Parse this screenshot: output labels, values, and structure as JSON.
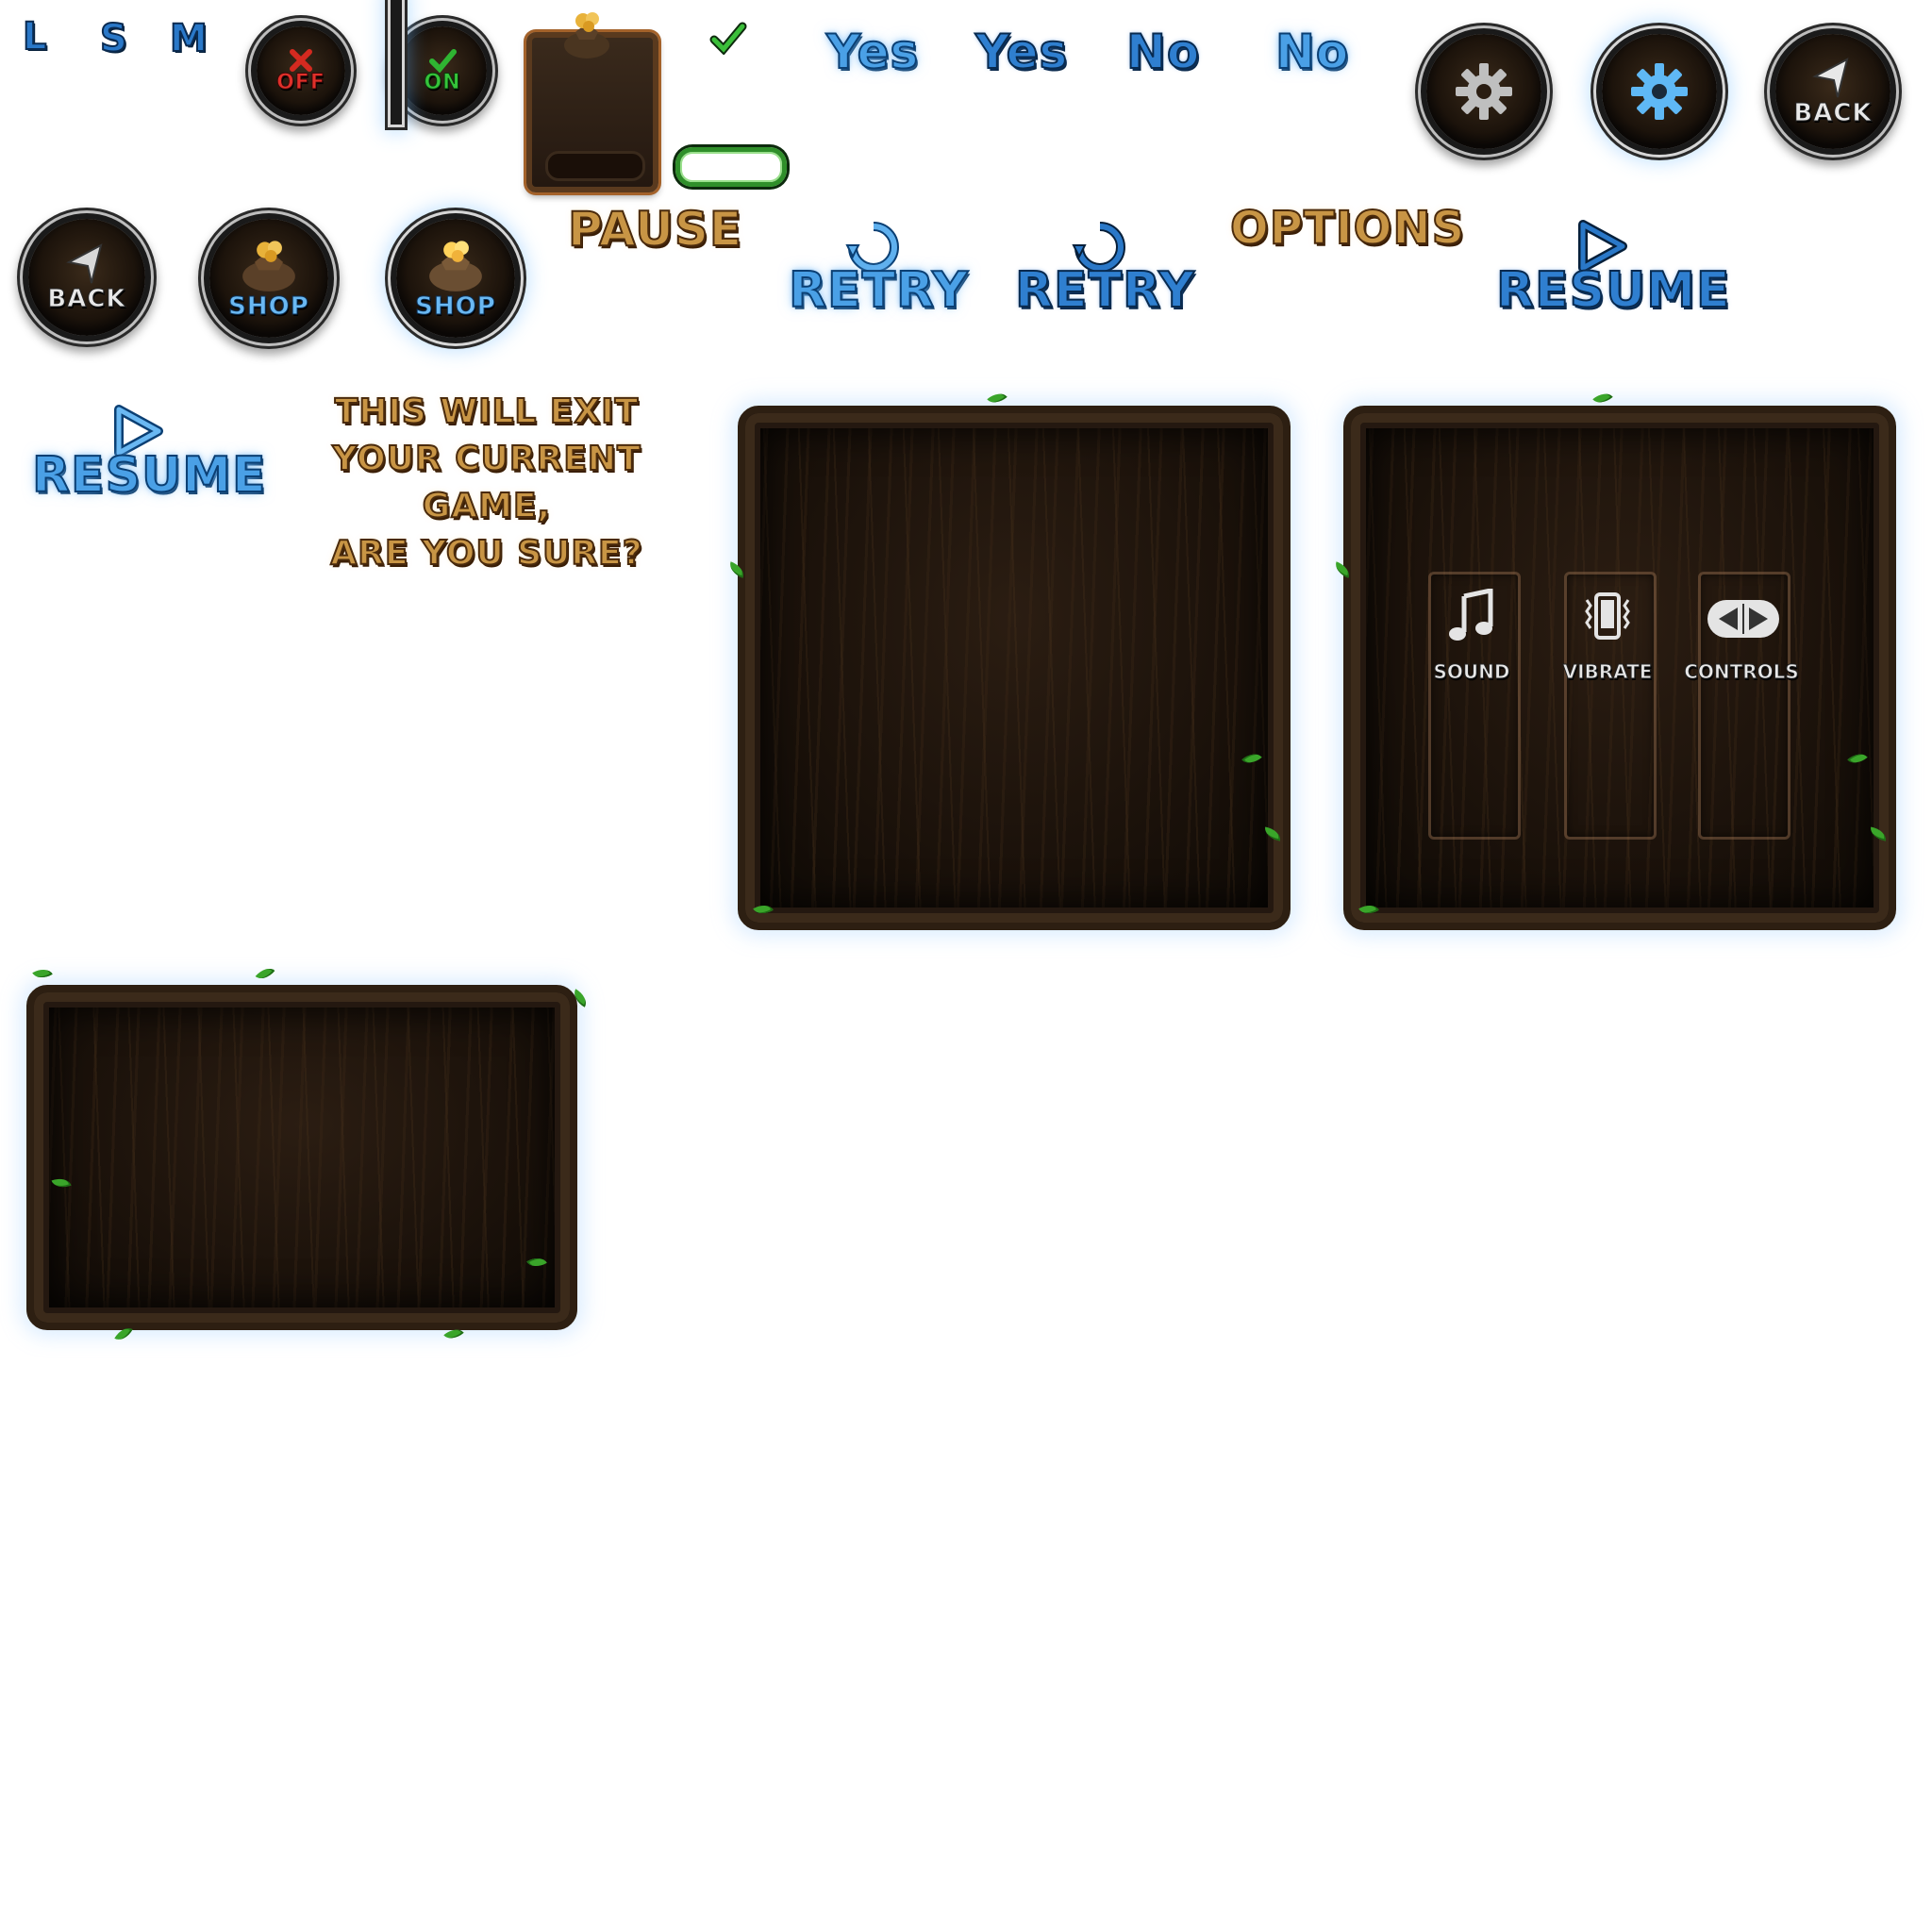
{
  "size_letters": [
    "L",
    "S",
    "M"
  ],
  "toggles": {
    "off_label": "OFF",
    "on_label": "ON"
  },
  "yes_labels": [
    "Yes",
    "Yes"
  ],
  "no_labels": [
    "No",
    "No"
  ],
  "back_label": "BACK",
  "shop_label": "SHOP",
  "pause_label": "PAUSE",
  "retry_labels": [
    "RETRY",
    "RETRY"
  ],
  "options_label": "OPTIONS",
  "resume_labels": [
    "RESUME",
    "RESUME"
  ],
  "exit_confirm": {
    "line1": "THIS WILL EXIT",
    "line2": "YOUR CURRENT GAME,",
    "line3": "ARE YOU SURE?"
  },
  "options_panel": {
    "sound_label": "SOUND",
    "vibrate_label": "VIBRATE",
    "controls_label": "CONTROLS"
  },
  "icons": [
    "gear-icon",
    "back-arrow-icon",
    "coin-bag-icon",
    "retry-icon",
    "play-icon",
    "music-note-icon",
    "phone-vibrate-icon",
    "arrows-icon",
    "check-icon",
    "cross-icon"
  ],
  "colors": {
    "accent_blue": "#4aa0e6",
    "gold": "#c89545",
    "wood_dark": "#1a110a",
    "leaf_green": "#3aa52a",
    "off_red": "#e0302a",
    "on_green": "#35c43a"
  }
}
